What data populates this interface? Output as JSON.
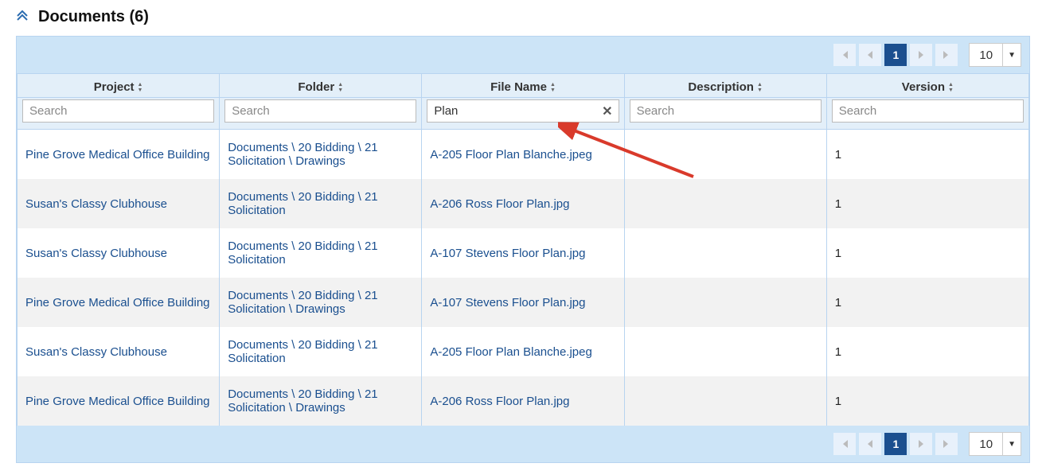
{
  "title": "Documents (6)",
  "pager": {
    "current_page": "1",
    "page_size": "10"
  },
  "columns": {
    "project": "Project",
    "folder": "Folder",
    "filename": "File Name",
    "description": "Description",
    "version": "Version"
  },
  "filters": {
    "placeholder": "Search",
    "project": "",
    "folder": "",
    "filename": "Plan",
    "description": "",
    "version": ""
  },
  "rows": [
    {
      "project": "Pine Grove Medical Office Building",
      "folder": "Documents \\ 20 Bidding \\ 21 Solicitation \\ Drawings",
      "filename": "A-205 Floor Plan Blanche.jpeg",
      "description": "",
      "version": "1"
    },
    {
      "project": "Susan's Classy Clubhouse",
      "folder": "Documents \\ 20 Bidding \\ 21 Solicitation",
      "filename": "A-206 Ross Floor Plan.jpg",
      "description": "",
      "version": "1"
    },
    {
      "project": "Susan's Classy Clubhouse",
      "folder": "Documents \\ 20 Bidding \\ 21 Solicitation",
      "filename": "A-107 Stevens Floor Plan.jpg",
      "description": "",
      "version": "1"
    },
    {
      "project": "Pine Grove Medical Office Building",
      "folder": "Documents \\ 20 Bidding \\ 21 Solicitation \\ Drawings",
      "filename": "A-107 Stevens Floor Plan.jpg",
      "description": "",
      "version": "1"
    },
    {
      "project": "Susan's Classy Clubhouse",
      "folder": "Documents \\ 20 Bidding \\ 21 Solicitation",
      "filename": "A-205 Floor Plan Blanche.jpeg",
      "description": "",
      "version": "1"
    },
    {
      "project": "Pine Grove Medical Office Building",
      "folder": "Documents \\ 20 Bidding \\ 21 Solicitation \\ Drawings",
      "filename": "A-206 Ross Floor Plan.jpg",
      "description": "",
      "version": "1"
    }
  ]
}
